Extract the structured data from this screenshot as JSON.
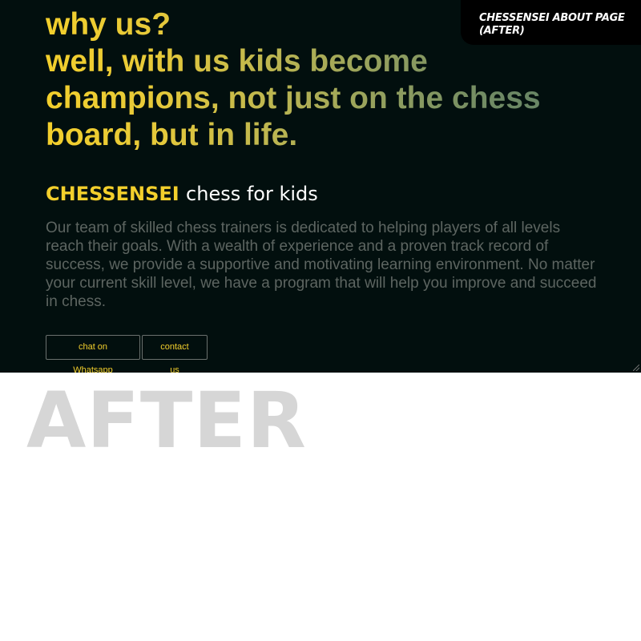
{
  "page": {
    "headline_lines": [
      "why us?",
      "well, with us kids become",
      "champions, not just on the chess",
      "board, but in life."
    ],
    "subtitle": {
      "brand": "CHESSENSEI",
      "rest": "chess for kids"
    },
    "body": "Our team of skilled chess trainers is dedicated to helping players of all levels reach their goals. With a wealth of experience and a proven track record of success, we provide a supportive and motivating learning environment. No matter your current skill level, we have a program that will help you improve and succeed in chess.",
    "buttons": {
      "whatsapp": "chat on Whatsapp",
      "contact": "contact us"
    }
  },
  "overlay": {
    "corner_label": "CHESSENSEI ABOUT PAGE (AFTER)",
    "watermark": "AFTER"
  },
  "colors": {
    "background": "#020f0e",
    "accent_yellow": "#f3cf2c",
    "body_text": "#5d6561"
  },
  "icons": {
    "resize_grip": "resize-grip-icon"
  }
}
